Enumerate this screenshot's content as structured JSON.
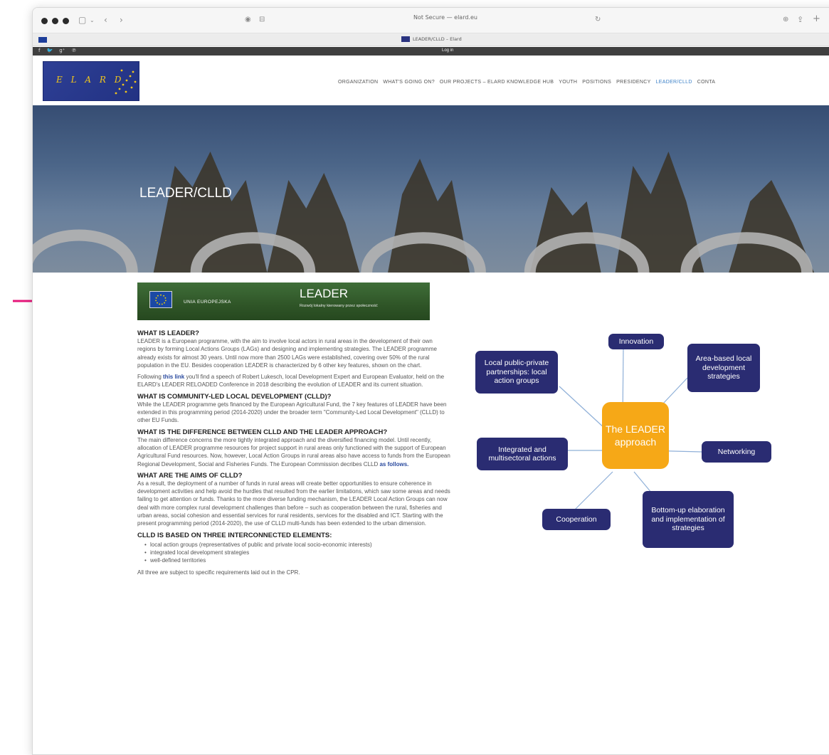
{
  "browser": {
    "address": "Not Secure — elard.eu",
    "tab_title": "LEADER/CLLD – Elard",
    "login": "Log in",
    "social": [
      "f",
      "🐦",
      "g⁺",
      "℗"
    ]
  },
  "header": {
    "logo_text": "E L A R D",
    "nav": [
      "ORGANIZATION",
      "WHAT'S GOING ON?",
      "OUR PROJECTS – ELARD KNOWLEDGE HUB",
      "YOUTH",
      "POSITIONS",
      "PRESIDENCY",
      "LEADER/CLLD",
      "CONTA"
    ],
    "active_nav": "LEADER/CLLD"
  },
  "hero": {
    "title": "LEADER/CLLD"
  },
  "banner": {
    "eu_label": "UNIA EUROPEJSKA",
    "title": "LEADER",
    "subtitle": "Rozwój lokalny kierowany przez społeczność"
  },
  "article": {
    "h1": "WHAT IS LEADER?",
    "p1": "LEADER is a European programme, with the aim to involve local actors in rural areas in the development of their own regions by forming Local Actions Groups (LAGs) and designing and implementing strategies. The LEADER programme already exists for almost 30 years. Until now more than 2500 LAGs were established, covering over 50% of the rural population in the EU. Besides cooperation LEADER is characterized by 6 other key features, shown on the chart.",
    "p2_pre": "Following ",
    "p2_link": "this link",
    "p2_post": " you'll find a speech of Robert Lukesch, local Development Expert and European Evaluator, held on the ELARD's LEADER RELOADED Conference in 2018 describing the evolution of LEADER and its current situation.",
    "h2": "WHAT IS COMMUNITY-LED LOCAL DEVELOPMENT (CLLD)?",
    "p3": "While the LEADER programme gets financed by the European Agricultural Fund, the 7 key features of LEADER have been extended in this programming period (2014-2020) under the broader term \"Community-Led Local Development\" (CLLD) to other EU Funds.",
    "h3": "WHAT IS THE DIFFERENCE BETWEEN CLLD AND THE LEADER APPROACH?",
    "p4_pre": "The main difference concerns the more tightly integrated approach and the diversified financing model. Until recently, allocation of LEADER programme resources for project support in rural areas only functioned with the support of European Agricultural Fund resources. Now, however, Local Action Groups in rural areas also have access to funds from the European Regional Development, Social and Fisheries Funds. The European Commission decribes CLLD ",
    "p4_link": "as follows.",
    "h4": "WHAT ARE THE AIMS OF CLLD?",
    "p5": "As a result, the deployment of a number of funds in rural areas will create better opportunities to ensure coherence in development activities and help avoid the hurdles that resulted from the earlier limitations, which saw some areas and needs failing to get attention or funds. Thanks to the more diverse funding mechanism, the LEADER Local Action Groups can now deal with more complex rural development challenges than before – such as cooperation between the rural, fisheries and urban areas, social cohesion and essential services for rural residents, services for the disabled and ICT. Starting with the present programming period (2014-2020), the use of CLLD multi-funds has been extended to the urban dimension.",
    "h5": "CLLD IS BASED ON THREE INTERCONNECTED ELEMENTS:",
    "bullets": [
      "local action groups (representatives of public and private local socio-economic interests)",
      "integrated local development strategies",
      "well-defined territories"
    ],
    "p6": "All three are subject to specific requirements laid out in the CPR."
  },
  "diagram": {
    "center": "The LEADER approach",
    "innovation": "Innovation",
    "area_based": "Area-based local development strategies",
    "local_partnerships": "Local public-private partnerships: local action groups",
    "integrated": "Integrated and multisectoral actions",
    "networking": "Networking",
    "cooperation": "Cooperation",
    "bottom_up": "Bottom-up elaboration and implementation of strategies"
  },
  "colors": {
    "node": "#2a2c72",
    "center": "#f6a817",
    "arrow": "#e6167a",
    "banner": "#2f5527",
    "nav_active": "#3d82c8"
  }
}
